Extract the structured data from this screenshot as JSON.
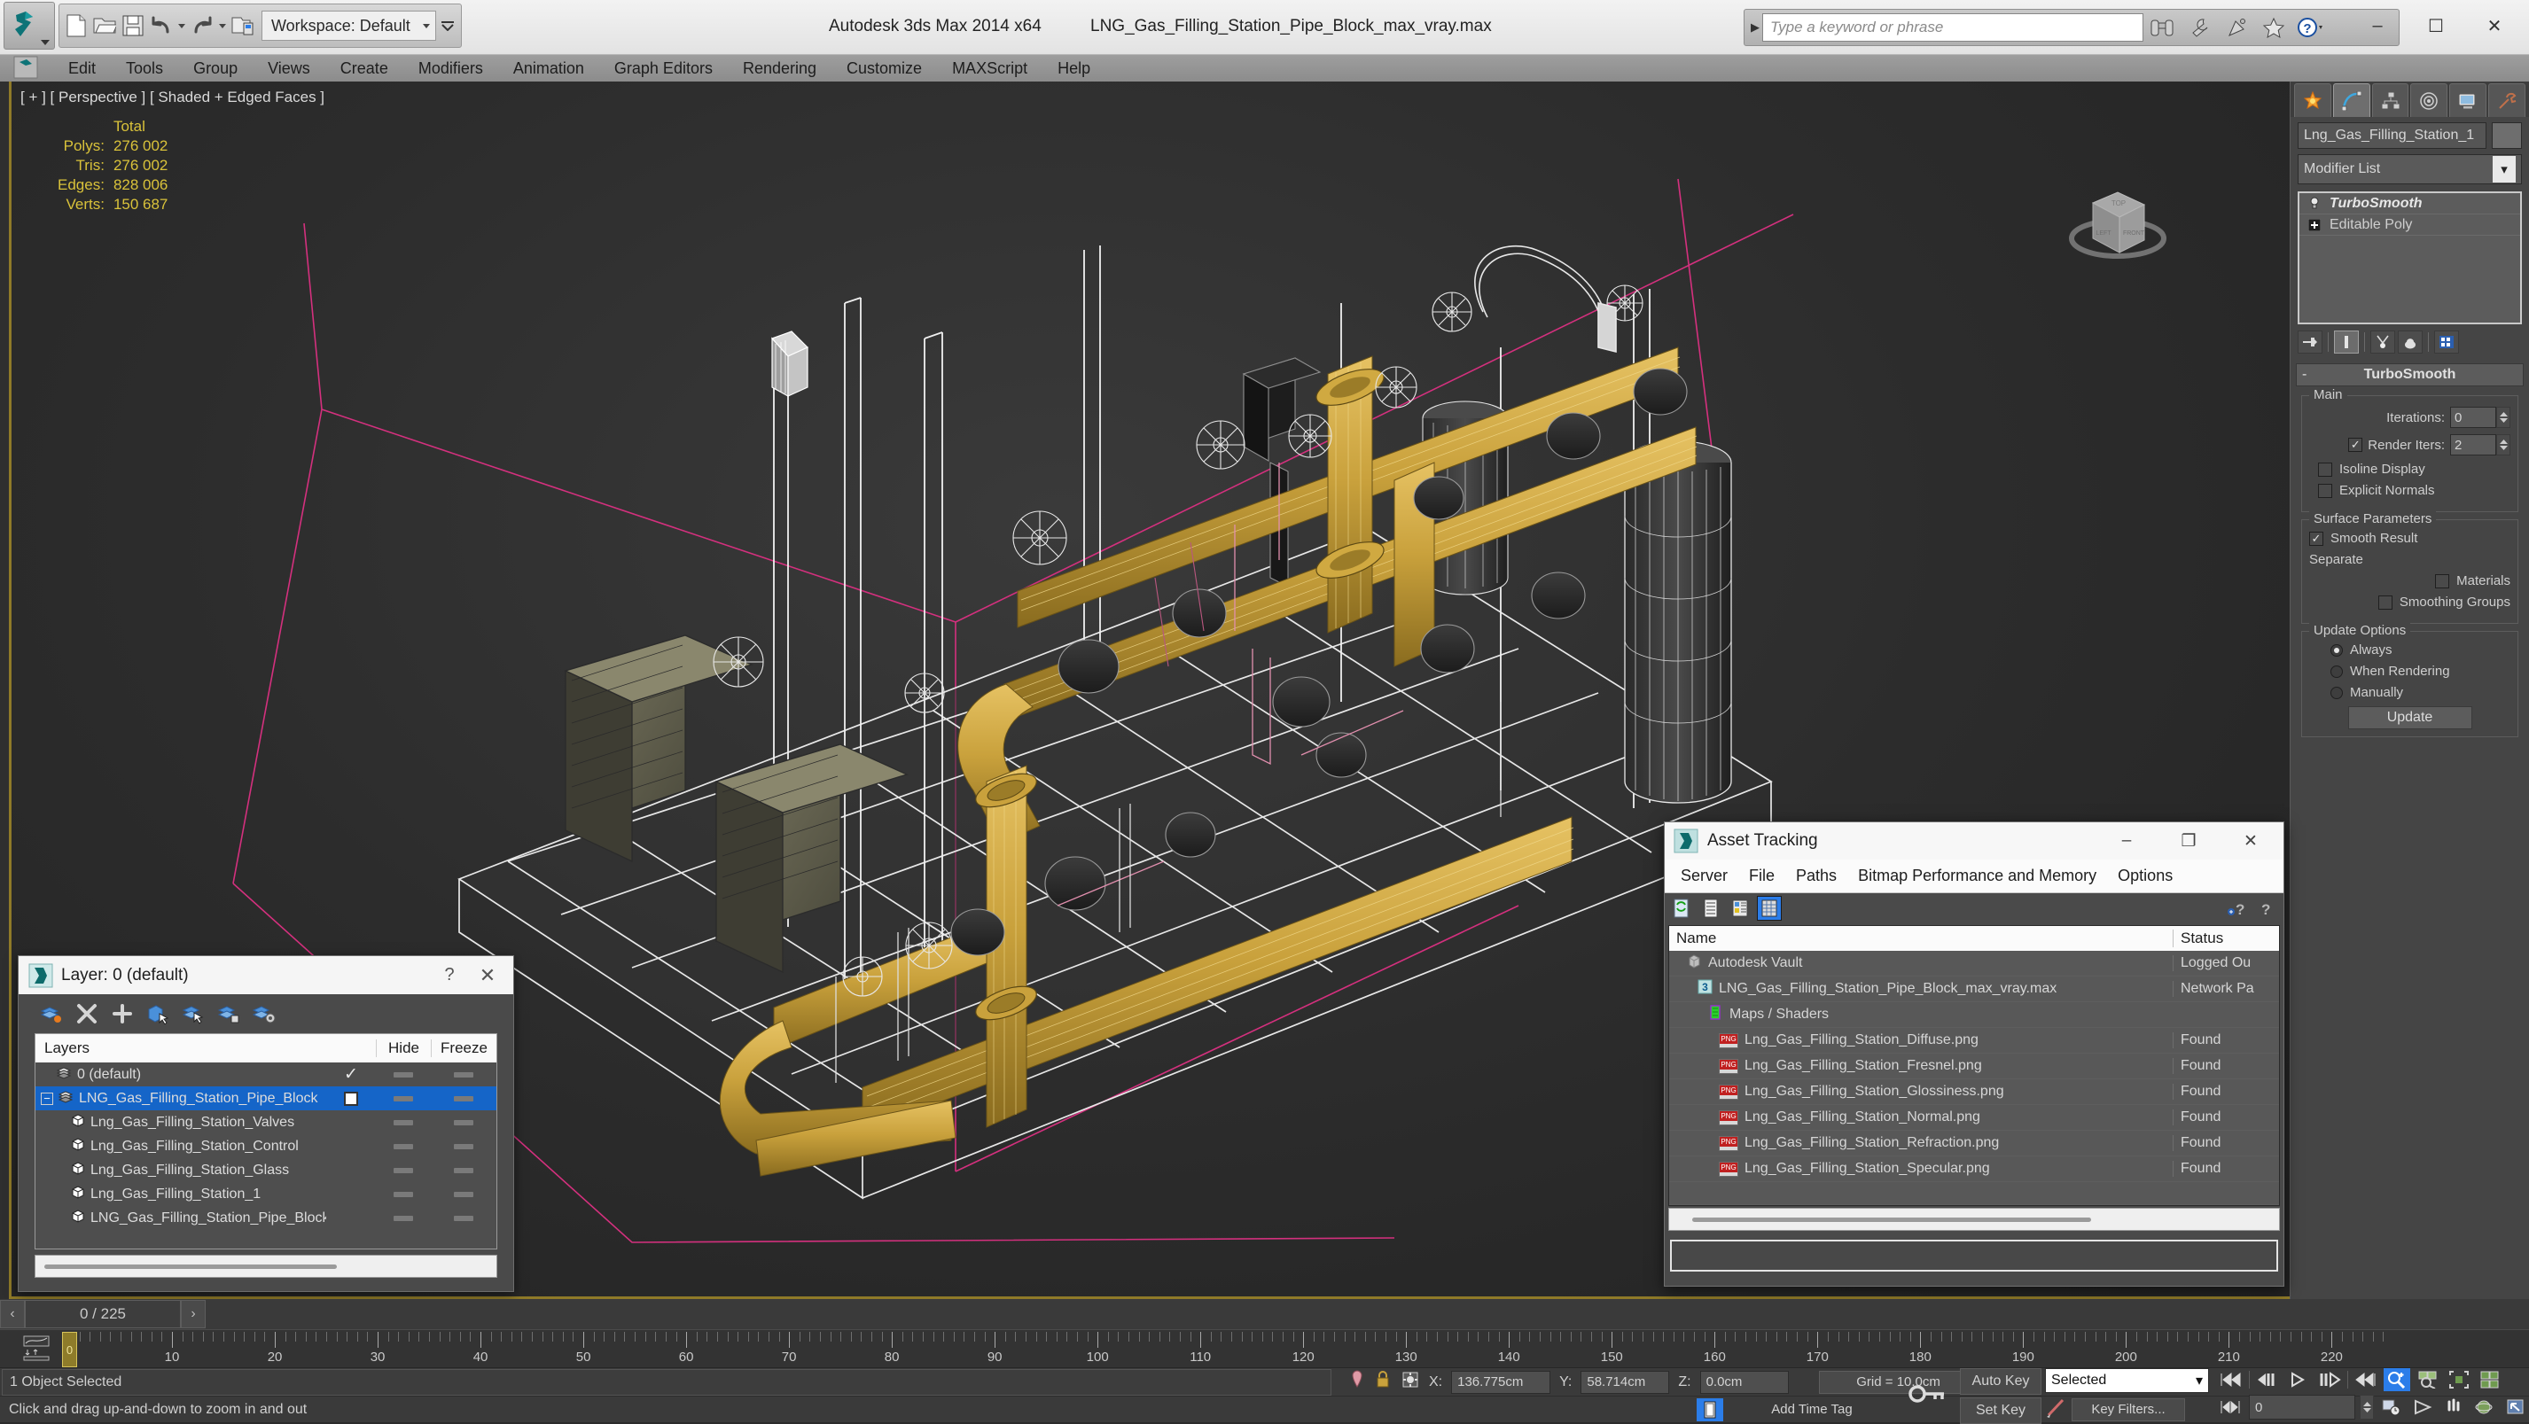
{
  "titlebar": {
    "workspace": "Workspace: Default",
    "app_title": "Autodesk 3ds Max  2014 x64",
    "file_title": "LNG_Gas_Filling_Station_Pipe_Block_max_vray.max",
    "search_placeholder": "Type a keyword or phrase",
    "quick_access": [
      "new-icon",
      "open-icon",
      "save-icon",
      "undo-icon",
      "redo-icon",
      "setproject-icon"
    ],
    "info_icons": [
      "binoculars-icon",
      "wrench-icon",
      "satellite-icon",
      "star-icon",
      "help-icon"
    ],
    "window_buttons": [
      "minimize",
      "maximize",
      "close"
    ]
  },
  "menubar": {
    "items": [
      "Edit",
      "Tools",
      "Group",
      "Views",
      "Create",
      "Modifiers",
      "Animation",
      "Graph Editors",
      "Rendering",
      "Customize",
      "MAXScript",
      "Help"
    ]
  },
  "viewport": {
    "label": "[ + ] [ Perspective ] [ Shaded + Edged Faces ]",
    "stats_header": "Total",
    "stats": [
      {
        "label": "Polys:",
        "value": "276 002"
      },
      {
        "label": "Tris:",
        "value": "276 002"
      },
      {
        "label": "Edges:",
        "value": "828 006"
      },
      {
        "label": "Verts:",
        "value": "150 687"
      }
    ]
  },
  "command_panel": {
    "tabs": [
      "create-tab",
      "modify-tab",
      "hierarchy-tab",
      "motion-tab",
      "display-tab",
      "utilities-tab"
    ],
    "selected_tab_index": 1,
    "object_name": "Lng_Gas_Filling_Station_1",
    "modifier_list_label": "Modifier List",
    "stack": [
      {
        "label": "TurboSmooth",
        "icon": "lightbulb-icon",
        "active": true
      },
      {
        "label": "Editable Poly",
        "icon": "plus-box-icon",
        "active": false
      }
    ],
    "stack_tools": [
      "pin-stack-icon",
      "show-end-result-icon",
      "make-unique-icon",
      "remove-modifier-icon",
      "configure-sets-icon"
    ],
    "rollout": {
      "title": "TurboSmooth",
      "collapse_glyph": "-",
      "groups": {
        "main": {
          "title": "Main",
          "iterations_label": "Iterations:",
          "iterations_value": "0",
          "render_iters_label": "Render Iters:",
          "render_iters_value": "2",
          "render_iters_checked": true,
          "isoline_label": "Isoline Display",
          "isoline_checked": false,
          "explicit_label": "Explicit Normals",
          "explicit_checked": false
        },
        "surface": {
          "title": "Surface Parameters",
          "smooth_result_label": "Smooth Result",
          "smooth_result_checked": true,
          "separate_label": "Separate",
          "materials_label": "Materials",
          "materials_checked": false,
          "smoothing_groups_label": "Smoothing Groups",
          "smoothing_groups_checked": false
        },
        "update": {
          "title": "Update Options",
          "options": [
            "Always",
            "When Rendering",
            "Manually"
          ],
          "selected_index": 0,
          "button_label": "Update"
        }
      }
    }
  },
  "layer_dialog": {
    "title": "Layer: 0 (default)",
    "help_glyph": "?",
    "close_glyph": "✕",
    "tools": [
      "new-layer-icon",
      "delete-layer-icon",
      "add-layer-icon",
      "select-objects-icon",
      "select-highlight-icon",
      "add-selection-icon",
      "layer-settings-icon"
    ],
    "columns": [
      "Layers",
      "Hide",
      "Freeze"
    ],
    "rows": [
      {
        "name": "0 (default)",
        "indent": 0,
        "icon": "layer-icon",
        "current": "✓",
        "selected": false
      },
      {
        "name": "LNG_Gas_Filling_Station_Pipe_Block",
        "indent": 0,
        "icon": "layer-icon",
        "current": "box",
        "selected": true,
        "expander": "-"
      },
      {
        "name": "Lng_Gas_Filling_Station_Valves",
        "indent": 1,
        "icon": "object-icon",
        "current": "",
        "selected": false
      },
      {
        "name": "Lng_Gas_Filling_Station_Control",
        "indent": 1,
        "icon": "object-icon",
        "current": "",
        "selected": false
      },
      {
        "name": "Lng_Gas_Filling_Station_Glass",
        "indent": 1,
        "icon": "object-icon",
        "current": "",
        "selected": false
      },
      {
        "name": "Lng_Gas_Filling_Station_1",
        "indent": 1,
        "icon": "object-icon",
        "current": "",
        "selected": false
      },
      {
        "name": "LNG_Gas_Filling_Station_Pipe_Block",
        "indent": 1,
        "icon": "object-icon",
        "current": "",
        "selected": false
      }
    ]
  },
  "asset_tracking": {
    "title": "Asset Tracking",
    "window_buttons": [
      "–",
      "❐",
      "✕"
    ],
    "menu": [
      "Server",
      "File",
      "Paths",
      "Bitmap Performance and Memory",
      "Options"
    ],
    "toolbar_icons": [
      "refresh-icon",
      "list-view-icon",
      "detail-view-icon",
      "grid-view-icon"
    ],
    "toolbar_right_icons": [
      "help-add-icon",
      "help-icon"
    ],
    "columns": [
      "Name",
      "Status"
    ],
    "rows": [
      {
        "name": "Autodesk Vault",
        "status": "Logged Ou",
        "indent": 0,
        "icon": "vault-icon"
      },
      {
        "name": "LNG_Gas_Filling_Station_Pipe_Block_max_vray.max",
        "status": "Network Pa",
        "indent": 1,
        "icon": "max-file-icon"
      },
      {
        "name": "Maps / Shaders",
        "status": "",
        "indent": 2,
        "icon": "maps-icon"
      },
      {
        "name": "Lng_Gas_Filling_Station_Diffuse.png",
        "status": "Found",
        "indent": 3,
        "icon": "png-icon"
      },
      {
        "name": "Lng_Gas_Filling_Station_Fresnel.png",
        "status": "Found",
        "indent": 3,
        "icon": "png-icon"
      },
      {
        "name": "Lng_Gas_Filling_Station_Glossiness.png",
        "status": "Found",
        "indent": 3,
        "icon": "png-icon"
      },
      {
        "name": "Lng_Gas_Filling_Station_Normal.png",
        "status": "Found",
        "indent": 3,
        "icon": "png-icon"
      },
      {
        "name": "Lng_Gas_Filling_Station_Refraction.png",
        "status": "Found",
        "indent": 3,
        "icon": "png-icon"
      },
      {
        "name": "Lng_Gas_Filling_Station_Specular.png",
        "status": "Found",
        "indent": 3,
        "icon": "png-icon"
      }
    ]
  },
  "timeline": {
    "current_frame": "0 / 225",
    "prev_glyph": "‹",
    "next_glyph": "›",
    "slider_label": "0",
    "tick_labels": [
      10,
      20,
      30,
      40,
      50,
      60,
      70,
      80,
      90,
      100,
      110,
      120,
      130,
      140,
      150,
      160,
      170,
      180,
      190,
      200,
      210,
      220
    ],
    "max_frame": 225
  },
  "statusbar": {
    "selection_text": "1 Object Selected",
    "prompt_text": "Click and drag up-and-down to zoom in and out",
    "coords": [
      {
        "axis": "X:",
        "value": "136.775cm"
      },
      {
        "axis": "Y:",
        "value": "58.714cm"
      },
      {
        "axis": "Z:",
        "value": "0.0cm"
      }
    ],
    "grid_text": "Grid = 10.0cm",
    "add_time_tag": "Add Time Tag",
    "auto_key": "Auto Key",
    "set_key": "Set Key",
    "selected_filter": "Selected",
    "key_filters": "Key Filters...",
    "spinner_value": "0",
    "lock_icon": "lock-icon",
    "pin_icon": "pin-icon",
    "isolate_icon": "isolate-selection-icon",
    "key_icon": "key-mode-toggle-icon",
    "playback_icons": [
      "go-to-start",
      "previous-frame",
      "play",
      "next-frame",
      "go-to-end"
    ],
    "nav_icons": [
      "zoom-icon",
      "zoom-all-icon",
      "zoom-extents-icon",
      "zoom-extents-all-icon",
      "field-of-view-icon",
      "pan-icon",
      "orbit-icon",
      "maximize-viewport-icon"
    ]
  },
  "colors": {
    "accent_gold": "#8f7a28",
    "selection_blue": "#1565c8",
    "stat_yellow": "#d9c23a",
    "gizmo_pink": "#d4307e",
    "pipe_gold": "#c9a13c",
    "wireframe_white": "#e8e8e8"
  }
}
